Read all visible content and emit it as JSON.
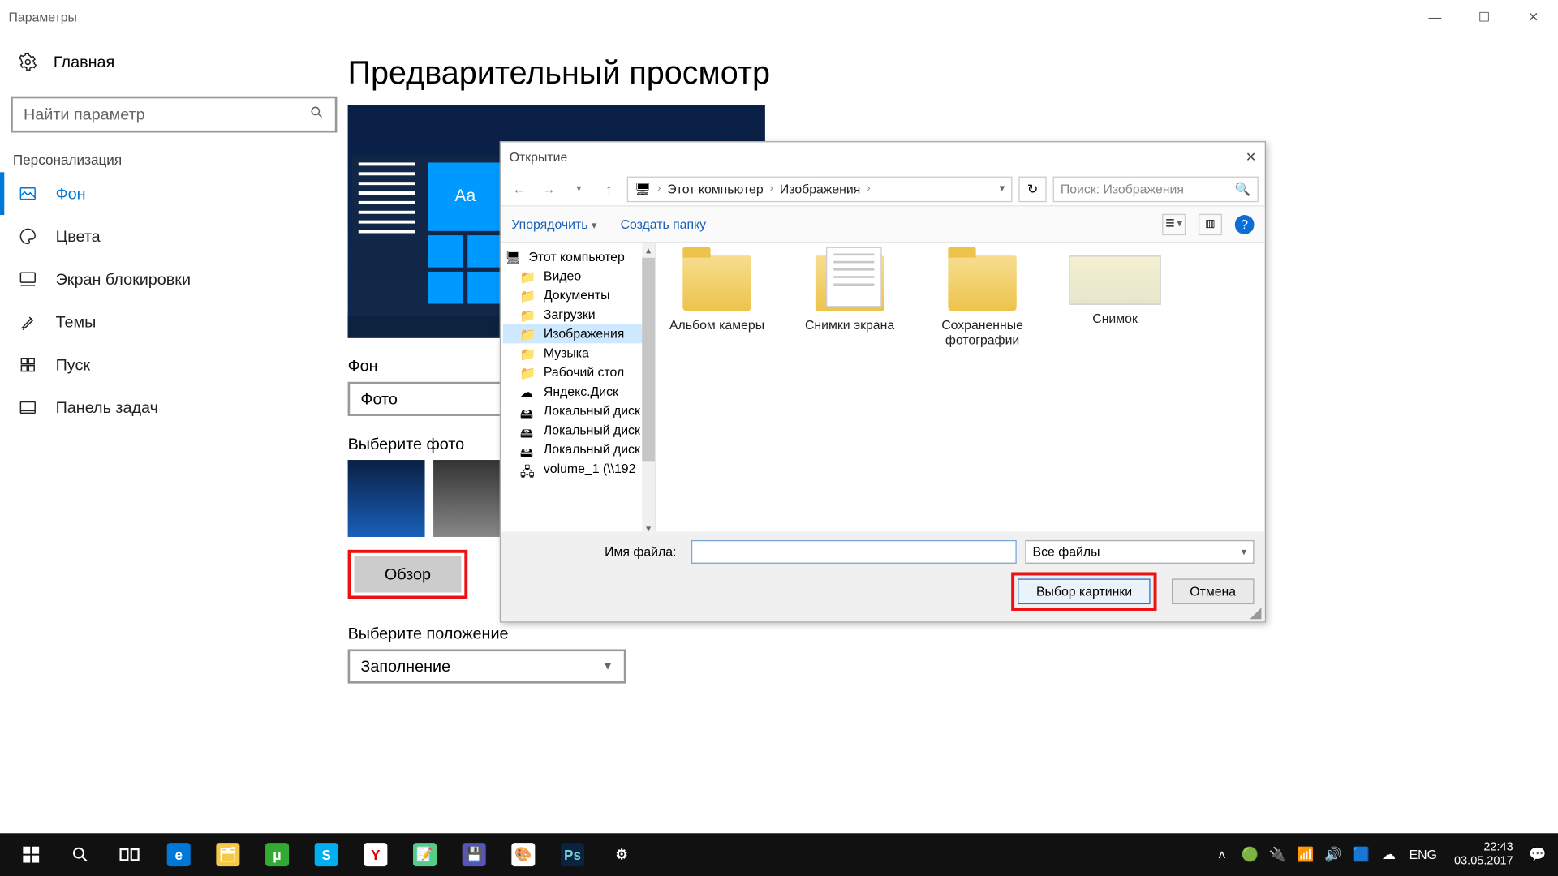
{
  "window": {
    "title": "Параметры"
  },
  "sidebar": {
    "home": "Главная",
    "search_placeholder": "Найти параметр",
    "category": "Персонализация",
    "items": [
      {
        "label": "Фон",
        "active": true
      },
      {
        "label": "Цвета"
      },
      {
        "label": "Экран блокировки"
      },
      {
        "label": "Темы"
      },
      {
        "label": "Пуск"
      },
      {
        "label": "Панель задач"
      }
    ]
  },
  "main": {
    "heading": "Предварительный просмотр",
    "preview_tile_text": "Aa",
    "bg_label": "Фон",
    "bg_value": "Фото",
    "choose_photo_label": "Выберите фото",
    "browse_button": "Обзор",
    "fit_label": "Выберите положение",
    "fit_value": "Заполнение"
  },
  "dialog": {
    "title": "Открытие",
    "breadcrumb": [
      "Этот компьютер",
      "Изображения"
    ],
    "search_placeholder": "Поиск: Изображения",
    "toolbar": {
      "organize": "Упорядочить",
      "new_folder": "Создать папку"
    },
    "tree": [
      {
        "label": "Этот компьютер",
        "icon": "pc"
      },
      {
        "label": "Видео",
        "icon": "folder"
      },
      {
        "label": "Документы",
        "icon": "folder"
      },
      {
        "label": "Загрузки",
        "icon": "folder"
      },
      {
        "label": "Изображения",
        "icon": "folder",
        "selected": true
      },
      {
        "label": "Музыка",
        "icon": "folder"
      },
      {
        "label": "Рабочий стол",
        "icon": "folder"
      },
      {
        "label": "Яндекс.Диск",
        "icon": "cloud"
      },
      {
        "label": "Локальный диск",
        "icon": "disk"
      },
      {
        "label": "Локальный диск",
        "icon": "disk"
      },
      {
        "label": "Локальный диск",
        "icon": "disk"
      },
      {
        "label": "volume_1 (\\\\192",
        "icon": "netdisk"
      }
    ],
    "files": [
      {
        "label": "Альбом камеры",
        "kind": "folder"
      },
      {
        "label": "Снимки экрана",
        "kind": "docfolder"
      },
      {
        "label": "Сохраненные фотографии",
        "kind": "folder"
      },
      {
        "label": "Снимок",
        "kind": "map"
      }
    ],
    "filename_label": "Имя файла:",
    "filter_value": "Все файлы",
    "open_button": "Выбор картинки",
    "cancel_button": "Отмена"
  },
  "taskbar": {
    "lang": "ENG",
    "time": "22:43",
    "date": "03.05.2017"
  }
}
